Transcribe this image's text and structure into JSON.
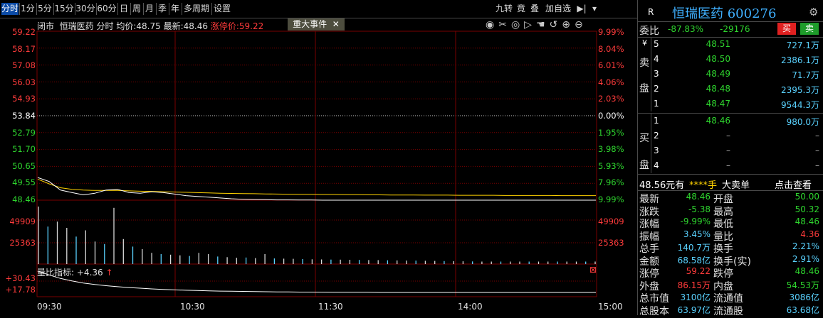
{
  "toolbar": {
    "items": [
      "分时",
      "1分",
      "5分",
      "15分",
      "30分",
      "60分",
      "日",
      "周",
      "月",
      "季",
      "年",
      "多周期",
      "设置"
    ],
    "active_index": 0,
    "right_items": [
      "九转",
      "竟",
      "叠",
      "加自选"
    ],
    "right_icons": [
      "play-end-icon",
      "dropdown-icon"
    ]
  },
  "chart": {
    "info_status": "闭市",
    "info_name": "恒瑞医药",
    "info_mode": "分时",
    "info_avg_label": "均价:",
    "info_avg_value": "48.75",
    "info_last_label": "最新:",
    "info_last_value": "48.46",
    "info_limit_label": "涨停价:",
    "info_limit_value": "59.22",
    "event_tab": "重大事件",
    "event_close": "✕",
    "tool_icons": [
      "eye-icon",
      "scissors-icon",
      "target-icon",
      "play-icon",
      "hand-icon",
      "undo-icon",
      "zoom-in-icon",
      "zoom-out-icon"
    ],
    "price_labels": [
      "59.22",
      "58.17",
      "57.08",
      "56.03",
      "54.93",
      "53.84",
      "52.79",
      "51.70",
      "50.65",
      "49.55",
      "48.46"
    ],
    "pct_labels": [
      "9.99%",
      "8.04%",
      "6.01%",
      "4.06%",
      "2.03%",
      "0.00%",
      "1.95%",
      "3.98%",
      "5.93%",
      "7.96%",
      "9.99%"
    ],
    "volume_labels": [
      "49909",
      "25363"
    ],
    "indicator_label": "量比指标:",
    "indicator_value": "+4.36",
    "indicator_arrow": "↑",
    "indicator_axis": [
      "+30.43",
      "+17.78"
    ],
    "time_labels": [
      "09:30",
      "10:30",
      "11:30",
      "14:00",
      "15:00"
    ],
    "colors": {
      "up": "#ff3b3b",
      "down": "#2ed42e",
      "grid": "#7a0000",
      "price_line": "#ffffff",
      "avg_line": "#ffd200",
      "volume": "#c8c8c8"
    }
  },
  "chart_data": {
    "type": "line",
    "series": [
      {
        "name": "价格",
        "values": [
          49.9,
          49.65,
          49.1,
          48.95,
          48.8,
          48.9,
          49.1,
          49.15,
          48.95,
          48.9,
          49.0,
          48.95,
          48.85,
          48.75,
          48.7,
          48.65,
          48.6,
          48.55,
          48.52,
          48.5,
          48.49,
          48.48,
          48.48,
          48.47,
          48.47,
          48.46,
          48.46,
          48.46,
          48.46,
          48.46,
          48.46,
          48.46,
          48.46,
          48.46,
          48.46,
          48.46,
          48.46,
          48.46,
          48.46,
          48.46,
          48.46,
          48.46,
          48.46,
          48.46,
          48.46,
          48.46,
          48.46,
          48.46,
          48.46,
          48.46
        ]
      },
      {
        "name": "均价",
        "values": [
          49.8,
          49.5,
          49.25,
          49.15,
          49.1,
          49.08,
          49.08,
          49.08,
          49.05,
          49.03,
          49.02,
          49.0,
          48.98,
          48.96,
          48.94,
          48.92,
          48.9,
          48.89,
          48.88,
          48.87,
          48.86,
          48.85,
          48.84,
          48.83,
          48.83,
          48.82,
          48.82,
          48.81,
          48.81,
          48.8,
          48.8,
          48.79,
          48.79,
          48.79,
          48.78,
          48.78,
          48.78,
          48.77,
          48.77,
          48.77,
          48.77,
          48.76,
          48.76,
          48.76,
          48.76,
          48.76,
          48.75,
          48.75,
          48.75,
          48.75
        ]
      }
    ],
    "ylim": [
      48.46,
      59.22
    ],
    "volume": [
      46000,
      30000,
      34000,
      29000,
      22000,
      27000,
      18000,
      16000,
      45000,
      20000,
      14000,
      12000,
      9000,
      8000,
      7500,
      7000,
      6500,
      9000,
      8000,
      6000,
      5500,
      5000,
      5200,
      4800,
      8000,
      4500,
      4300,
      4200,
      4000,
      3800,
      3700,
      3600,
      3500,
      3400,
      3300,
      3200,
      3100,
      3000,
      2900,
      2800,
      2700,
      2600,
      2500,
      2400,
      2300,
      2200,
      2100,
      2000,
      2000,
      2000,
      2000,
      2000,
      2000,
      2000,
      2000,
      2000,
      2000,
      2000,
      2000,
      2000
    ],
    "indicator": [
      30.43,
      28.2,
      26.1,
      24.6,
      23.4,
      22.5,
      21.8,
      21.2,
      20.7,
      20.3,
      19.9,
      19.6,
      19.3,
      19.1,
      18.9,
      18.7,
      18.6,
      18.5,
      18.4,
      18.3,
      18.2,
      18.1,
      18.1,
      18.0,
      18.0,
      17.95,
      17.9,
      17.9,
      17.85,
      17.85,
      17.8,
      17.8,
      17.8,
      17.78,
      17.78,
      17.78,
      17.78,
      17.78,
      17.78,
      17.78,
      17.78,
      17.78,
      17.78,
      17.78,
      17.78,
      17.78,
      17.78,
      17.78,
      17.78,
      17.78
    ]
  },
  "panel": {
    "r_label": "R",
    "stock_name": "恒瑞医药",
    "stock_code": "600276",
    "gear_icon": "gear-icon",
    "weibi_label": "委比",
    "weibi_pct": "-87.83%",
    "weibi_val": "-29176",
    "buy_btn": "买",
    "sell_btn": "卖",
    "sell_side_label": [
      "¥",
      "卖",
      "盘"
    ],
    "buy_side_label": [
      "买",
      "盘"
    ],
    "asks": [
      {
        "lvl": "5",
        "price": "48.51",
        "vol": "727.1万"
      },
      {
        "lvl": "4",
        "price": "48.50",
        "vol": "2386.1万"
      },
      {
        "lvl": "3",
        "price": "48.49",
        "vol": "71.7万"
      },
      {
        "lvl": "2",
        "price": "48.48",
        "vol": "2395.3万"
      },
      {
        "lvl": "1",
        "price": "48.47",
        "vol": "9544.3万"
      }
    ],
    "bids": [
      {
        "lvl": "1",
        "price": "48.46",
        "vol": "980.0万"
      },
      {
        "lvl": "2",
        "price": "–",
        "vol": "–"
      },
      {
        "lvl": "3",
        "price": "–",
        "vol": "–"
      },
      {
        "lvl": "4",
        "price": "–",
        "vol": "–"
      }
    ],
    "big_order_price": "48.56元有",
    "big_order_hand": "****手",
    "big_order_label": "大卖单",
    "big_order_link": "点击查看",
    "stats": [
      {
        "l1": "最新",
        "v1": "48.46",
        "c1": "green",
        "l2": "开盘",
        "v2": "50.00",
        "c2": "green"
      },
      {
        "l1": "涨跌",
        "v1": "-5.38",
        "c1": "green",
        "l2": "最高",
        "v2": "50.32",
        "c2": "green"
      },
      {
        "l1": "涨幅",
        "v1": "-9.99%",
        "c1": "green",
        "l2": "最低",
        "v2": "48.46",
        "c2": "green"
      },
      {
        "l1": "振幅",
        "v1": "3.45%",
        "c1": "cyan",
        "l2": "量比",
        "v2": "4.36",
        "c2": "red"
      },
      {
        "l1": "总手",
        "v1": "140.7万",
        "c1": "cyan",
        "l2": "换手",
        "v2": "2.21%",
        "c2": "cyan"
      },
      {
        "l1": "金额",
        "v1": "68.58亿",
        "c1": "cyan",
        "l2": "换手(实)",
        "v2": "2.91%",
        "c2": "cyan"
      },
      {
        "l1": "涨停",
        "v1": "59.22",
        "c1": "red",
        "l2": "跌停",
        "v2": "48.46",
        "c2": "green"
      },
      {
        "l1": "外盘",
        "v1": "86.15万",
        "c1": "red",
        "l2": "内盘",
        "v2": "54.53万",
        "c2": "green"
      },
      {
        "l1": "总市值",
        "v1": "3100亿",
        "c1": "cyan",
        "l2": "流通值",
        "v2": "3086亿",
        "c2": "cyan"
      },
      {
        "l1": "总股本",
        "v1": "63.97亿",
        "c1": "cyan",
        "l2": "流通股",
        "v2": "63.68亿",
        "c2": "cyan"
      }
    ]
  }
}
